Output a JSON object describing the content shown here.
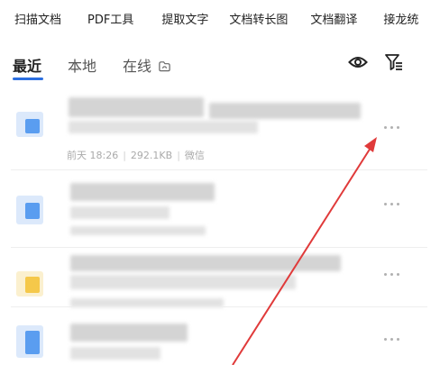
{
  "toolbar": {
    "items": [
      "扫描文档",
      "PDF工具",
      "提取文字",
      "文档转长图",
      "文档翻译",
      "接龙统"
    ]
  },
  "tabs": {
    "recent": "最近",
    "local": "本地",
    "online": "在线"
  },
  "files": [
    {
      "date": "前天 18:26",
      "size": "292.1KB",
      "source": "微信",
      "icon_color": "#5a9df0"
    },
    {
      "icon_color": "#5a9df0"
    },
    {
      "icon_color": "#f5c84a"
    },
    {
      "icon_color": "#5a9df0"
    }
  ],
  "colors": {
    "accent": "#2c6fe0",
    "annotation_arrow": "#e03a3a"
  },
  "icons": {
    "eye": "eye-icon",
    "filter": "filter-icon",
    "more": "more-icon",
    "online": "cloud-folder-icon"
  }
}
